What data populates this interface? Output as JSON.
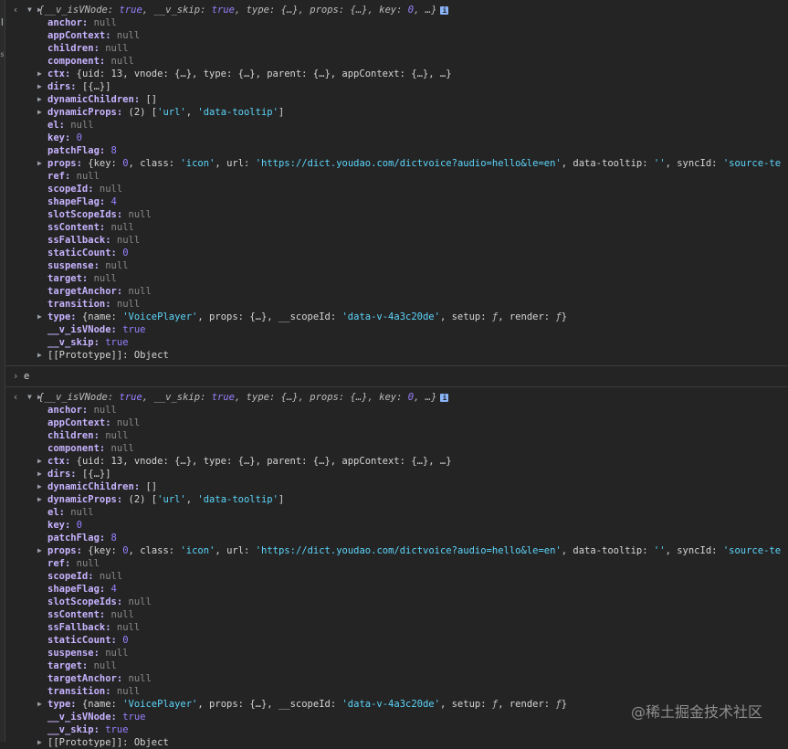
{
  "watermark": "@稀土掘金技术社区",
  "prompt": {
    "input": "e"
  },
  "vnode": {
    "summary": [
      "__v_isVNode",
      "true",
      "__v_skip",
      "true",
      "type",
      "{…}",
      "props",
      "{…}",
      "key",
      "0",
      "…"
    ],
    "info_glyph": "i",
    "fields": {
      "anchor": "null",
      "appContext": "null",
      "children": "null",
      "component": "null",
      "ctx": "{uid: 13, vnode: {…}, type: {…}, parent: {…}, appContext: {…}, …}",
      "dirs": "[{…}]",
      "dynamicChildren": "[]",
      "dynamicProps_count": "(2)",
      "dynamicProps_a": "'url'",
      "dynamicProps_b": "'data-tooltip'",
      "el": "null",
      "key": "0",
      "patchFlag": "8",
      "props": {
        "key_label": "key:",
        "key_val": "0",
        "class_label": "class:",
        "class_val": "'icon'",
        "url_label": "url:",
        "url_val": "'https://dict.youdao.com/dictvoice?audio=hello&le=en'",
        "tooltip_label": "data-tooltip:",
        "tooltip_val": "''",
        "sync_label": "syncId:",
        "sync_val": "'source-te"
      },
      "ref": "null",
      "scopeId": "null",
      "shapeFlag": "4",
      "slotScopeIds": "null",
      "ssContent": "null",
      "ssFallback": "null",
      "staticCount": "0",
      "suspense": "null",
      "target": "null",
      "targetAnchor": "null",
      "transition": "null",
      "type": {
        "name_label": "name:",
        "name_val": "'VoicePlayer'",
        "props_label": "props:",
        "props_val": "{…}",
        "scope_label": "__scopeId:",
        "scope_val": "'data-v-4a3c20de'",
        "setup_label": "setup:",
        "setup_val": "ƒ",
        "render_label": "render:",
        "render_val": "ƒ"
      },
      "isVNode": "true",
      "skip": "true",
      "prototype": "Object"
    },
    "labels": {
      "anchor": "anchor:",
      "appContext": "appContext:",
      "children": "children:",
      "component": "component:",
      "ctx": "ctx:",
      "dirs": "dirs:",
      "dynamicChildren": "dynamicChildren:",
      "dynamicProps": "dynamicProps:",
      "el": "el:",
      "key": "key:",
      "patchFlag": "patchFlag:",
      "props": "props:",
      "ref": "ref:",
      "scopeId": "scopeId:",
      "shapeFlag": "shapeFlag:",
      "slotScopeIds": "slotScopeIds:",
      "ssContent": "ssContent:",
      "ssFallback": "ssFallback:",
      "staticCount": "staticCount:",
      "suspense": "suspense:",
      "target": "target:",
      "targetAnchor": "targetAnchor:",
      "transition": "transition:",
      "type": "type:",
      "isVNode": "__v_isVNode:",
      "skip": "__v_skip:",
      "prototype": "[[Prototype]]:"
    }
  }
}
